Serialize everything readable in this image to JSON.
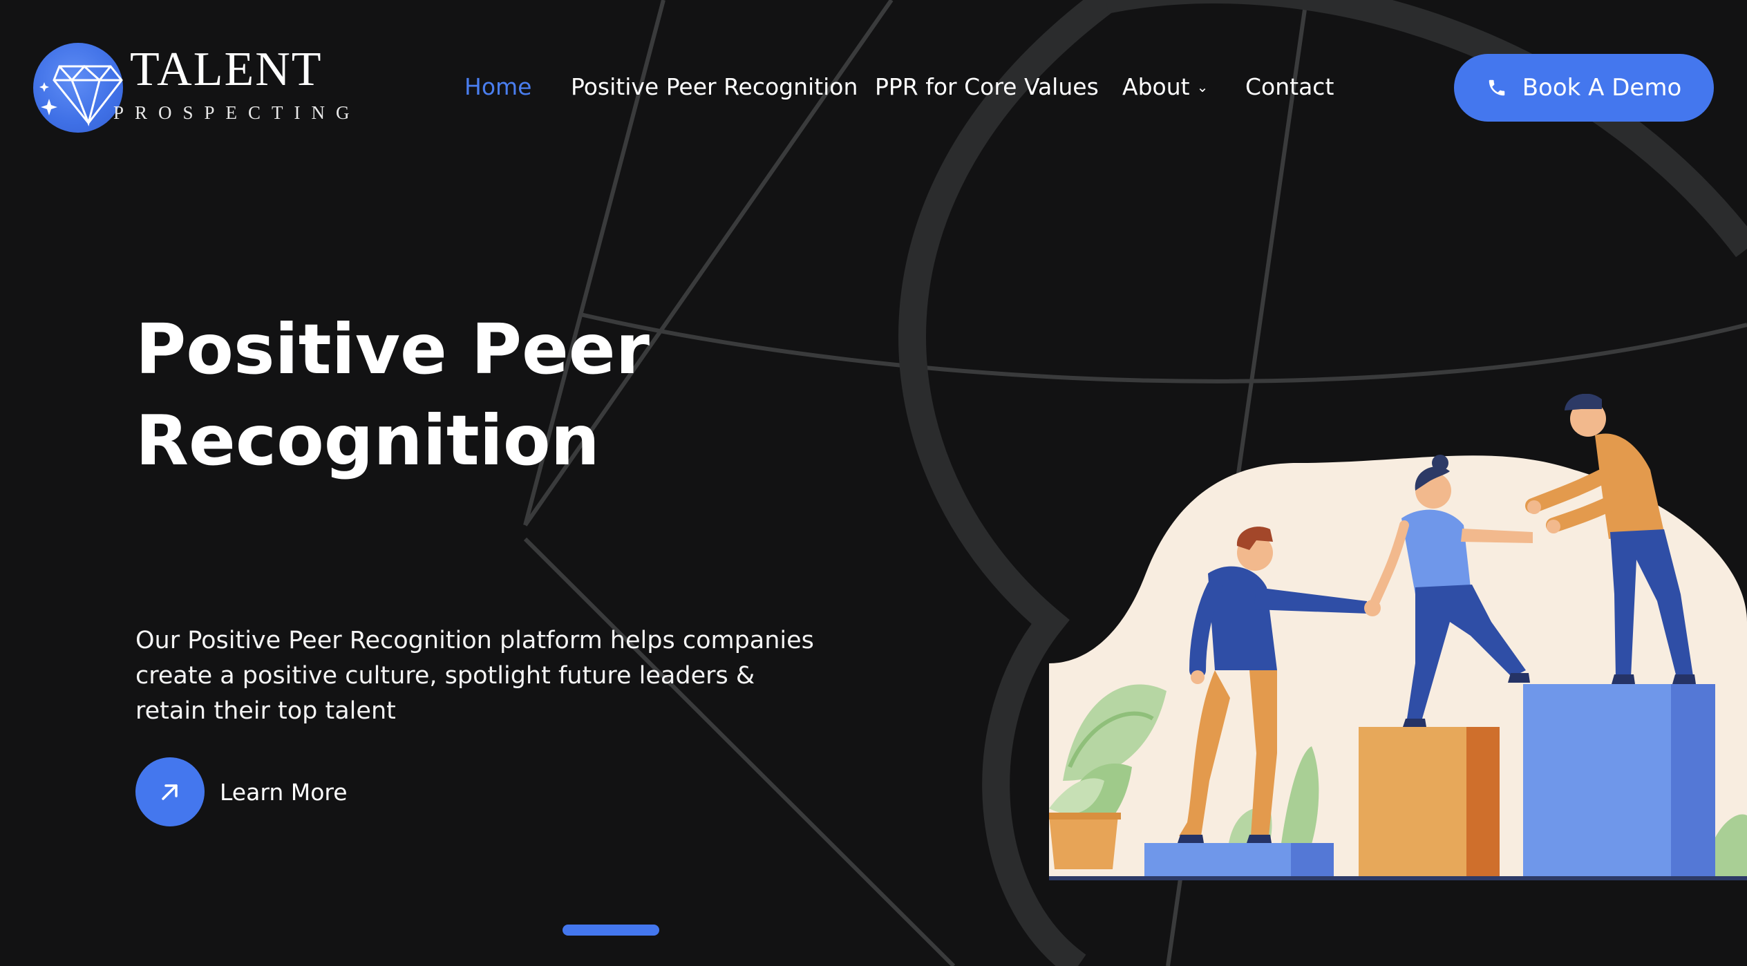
{
  "brand": {
    "name": "TALENT",
    "tagline": "PROSPECTING",
    "accent_color": "#4477ee",
    "background_color": "#121213"
  },
  "nav": {
    "items": [
      {
        "label": "Home",
        "active": true
      },
      {
        "label": "Positive Peer Recognition",
        "active": false
      },
      {
        "label": "PPR for Core Values",
        "active": false
      },
      {
        "label": "About",
        "active": false,
        "has_dropdown": true
      },
      {
        "label": "Contact",
        "active": false
      }
    ],
    "cta": {
      "label": "Book A Demo",
      "icon": "phone-icon"
    }
  },
  "hero": {
    "title_line1": "Positive Peer",
    "title_line2": "Recognition",
    "description": "Our Positive Peer Recognition platform helps companies create a positive culture, spotlight future leaders & retain their top talent",
    "learn_more": {
      "label": "Learn More",
      "icon": "arrow-up-right-icon"
    }
  },
  "slider": {
    "slides": 1,
    "active_index": 0
  }
}
